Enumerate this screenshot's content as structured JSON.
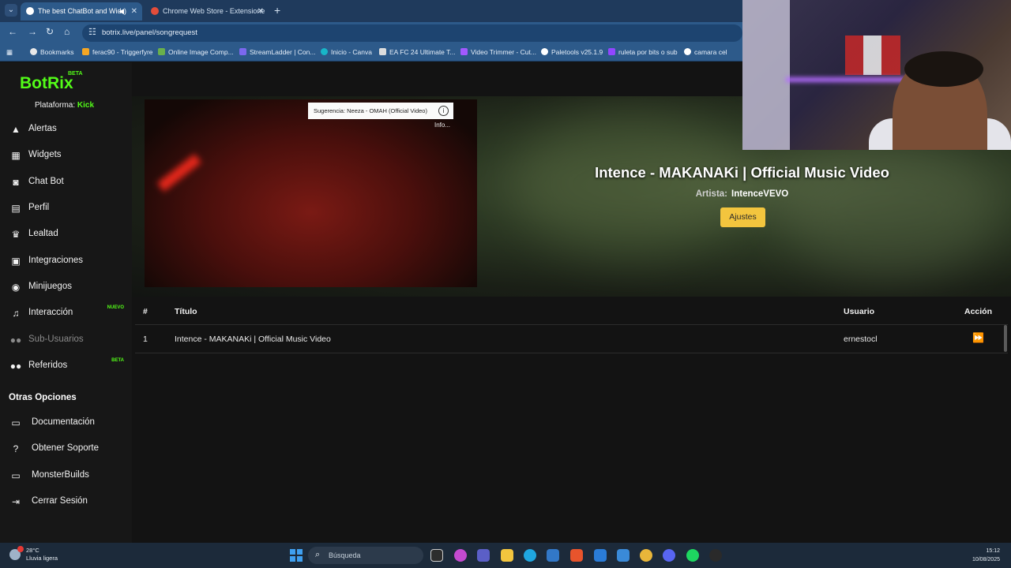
{
  "browser": {
    "tabs": [
      {
        "title": "The best ChatBot and Wid",
        "active": true
      },
      {
        "title": "Chrome Web Store - Extensione",
        "active": false
      }
    ],
    "url": "botrix.live/panel/songrequest",
    "bookmarks": [
      "Bookmarks",
      "ferac90 - Triggerfyre",
      "Online Image Comp...",
      "StreamLadder | Con...",
      "Inicio - Canva",
      "EA FC 24 Ultimate T...",
      "Video Trimmer - Cut...",
      "Paletools v25.1.9",
      "ruleta por bits o sub",
      "camara cel"
    ]
  },
  "sidebar": {
    "logo": "BotRix",
    "logo_badge": "BETA",
    "platform_label": "Plataforma:",
    "platform_value": "Kick",
    "items": [
      {
        "label": "Alertas",
        "icon": "warning-icon"
      },
      {
        "label": "Widgets",
        "icon": "grid-icon"
      },
      {
        "label": "Chat Bot",
        "icon": "robot-icon"
      },
      {
        "label": "Perfil",
        "icon": "id-card-icon"
      },
      {
        "label": "Lealtad",
        "icon": "trophy-icon"
      },
      {
        "label": "Integraciones",
        "icon": "chat-icon"
      },
      {
        "label": "Minijuegos",
        "icon": "gamepad-icon"
      },
      {
        "label": "Interacción",
        "icon": "music-icon",
        "tag": "NUEVO"
      },
      {
        "label": "Sub-Usuarios",
        "icon": "users-icon"
      },
      {
        "label": "Referidos",
        "icon": "users-icon",
        "tag": "BETA"
      }
    ],
    "section_title": "Otras Opciones",
    "options": [
      {
        "label": "Documentación",
        "icon": "scroll-icon"
      },
      {
        "label": "Obtener Soporte",
        "icon": "question-icon"
      },
      {
        "label": "MonsterBuilds",
        "icon": "laptop-icon"
      },
      {
        "label": "Cerrar Sesión",
        "icon": "logout-icon"
      }
    ]
  },
  "player": {
    "suggestion": "Sugerencia: Neeza - OMAH (Official Video)",
    "info_label": "Info...",
    "song_title": "Intence - MAKANAKi | Official Music Video",
    "artist_label": "Artista:",
    "artist_name": "IntenceVEVO",
    "settings_button": "Ajustes"
  },
  "queue": {
    "headers": {
      "num": "#",
      "title": "Título",
      "user": "Usuario",
      "action": "Acción"
    },
    "rows": [
      {
        "num": "1",
        "title": "Intence - MAKANAKi | Official Music Video",
        "user": "ernestocl"
      }
    ]
  },
  "taskbar": {
    "temperature": "28°C",
    "weather": "Lluvia ligera",
    "search_placeholder": "Búsqueda",
    "time": "15:12",
    "date": "10/08/2025"
  },
  "colors": {
    "brand_green": "#53fc18",
    "settings_yellow": "#f3c53e",
    "tag_red": "#e53935"
  }
}
